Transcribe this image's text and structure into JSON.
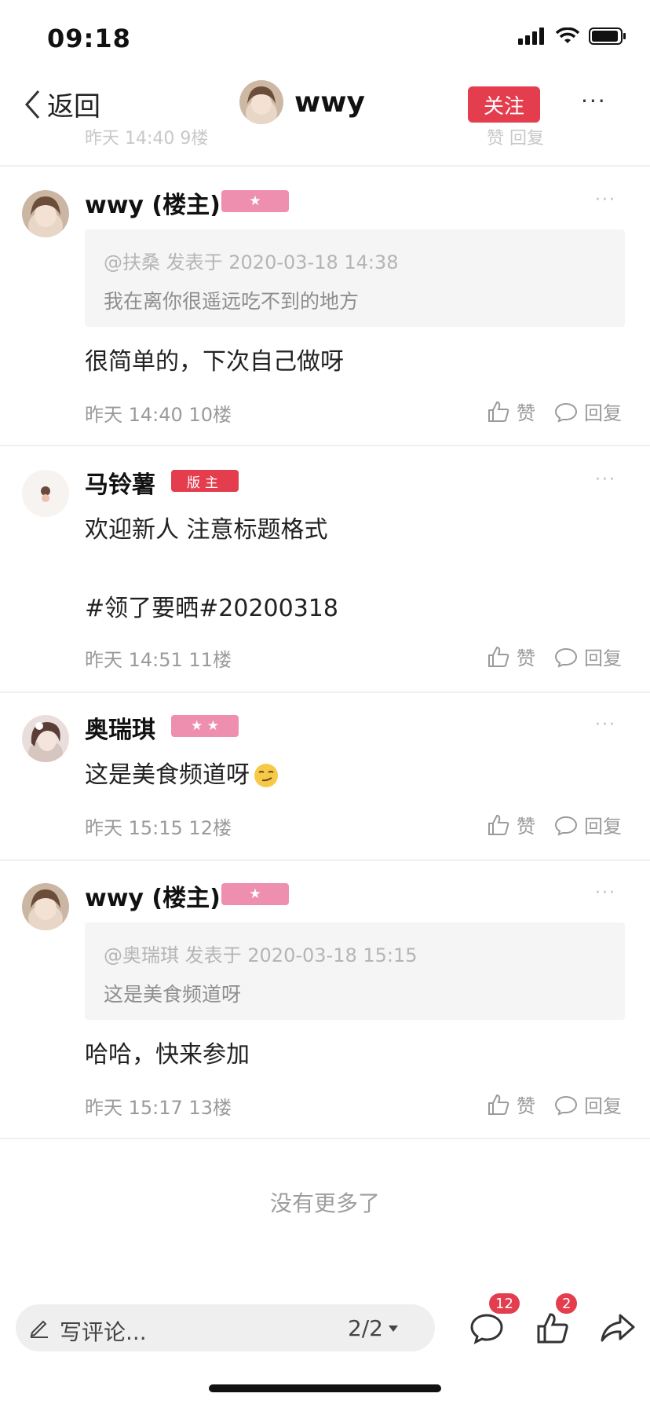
{
  "status_bar": {
    "time": "09:18"
  },
  "header": {
    "back_label": "返回",
    "title": "wwy",
    "follow_label": "关注",
    "more_label": "···"
  },
  "peek": {
    "left": "昨天 14:40 9楼",
    "right": "赞  回复"
  },
  "posts": [
    {
      "name": "wwy (楼主)",
      "badge": "★",
      "quote_meta": "@扶桑 发表于 2020-03-18 14:38",
      "quote_text": "我在离你很遥远吃不到的地方",
      "content": "很简单的，下次自己做呀",
      "meta": "昨天 14:40  10楼",
      "like": "赞",
      "reply": "回复"
    },
    {
      "name": "马铃薯",
      "badge": "版主",
      "content": "欢迎新人 注意标题格式\n\n#领了要晒#20200318",
      "meta": "昨天 14:51  11楼",
      "like": "赞",
      "reply": "回复"
    },
    {
      "name": "奥瑞琪",
      "badge": "★ ★",
      "content": "这是美食频道呀",
      "meta": "昨天 15:15  12楼",
      "like": "赞",
      "reply": "回复"
    },
    {
      "name": "wwy (楼主)",
      "badge": "★",
      "quote_meta": "@奥瑞琪 发表于 2020-03-18 15:15",
      "quote_text": "这是美食频道呀",
      "content": "哈哈，快来参加",
      "meta": "昨天 15:17  13楼",
      "like": "赞",
      "reply": "回复"
    }
  ],
  "footer_text": "没有更多了",
  "bottom_bar": {
    "comment_placeholder": "写评论...",
    "page_indicator": "2/2",
    "comment_count": "12",
    "like_count": "2"
  },
  "colors": {
    "accent": "#e43d4e",
    "badge_pink": "#ef8fb0"
  }
}
